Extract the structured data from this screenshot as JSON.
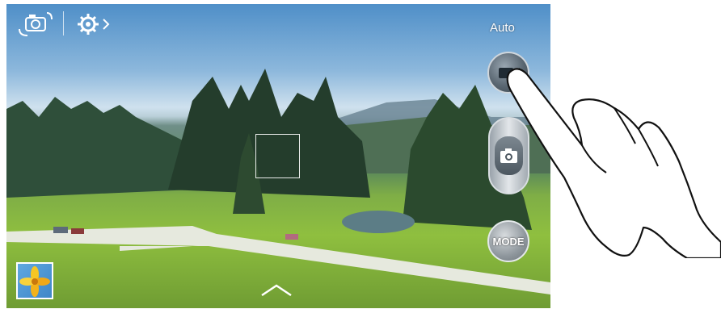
{
  "camera": {
    "mode_label": "Auto",
    "mode_button_label": "MODE"
  },
  "icons": {
    "switch_camera": "switch-camera-icon",
    "settings": "gear-icon",
    "record": "video-camera-icon",
    "shutter": "camera-icon",
    "gallery": "gallery-thumbnail",
    "expand": "chevron-up-icon"
  }
}
